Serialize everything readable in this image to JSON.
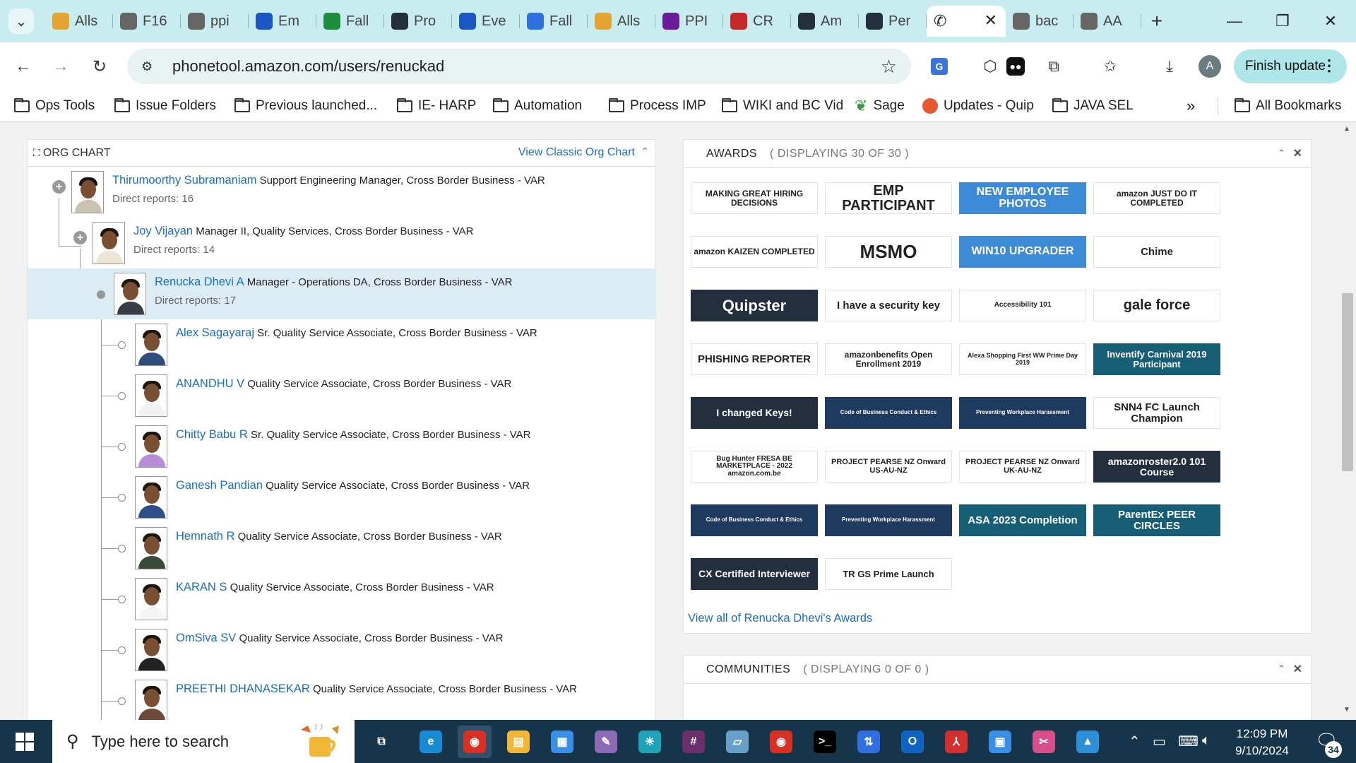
{
  "browser": {
    "tabs": [
      {
        "label": "Alls",
        "icon": "bee-icon",
        "color": "#e4a530"
      },
      {
        "label": "F16",
        "icon": "globe-icon",
        "color": "#666666"
      },
      {
        "label": "ppi",
        "icon": "globe-icon",
        "color": "#666666"
      },
      {
        "label": "Em",
        "icon": "mail-icon",
        "color": "#1a56c4"
      },
      {
        "label": "Fall",
        "icon": "sheet-icon",
        "color": "#1e8e3e"
      },
      {
        "label": "Pro",
        "icon": "quip-icon",
        "color": "#232f3e"
      },
      {
        "label": "Eve",
        "icon": "mail-icon",
        "color": "#1a56c4"
      },
      {
        "label": "Fall",
        "icon": "doc-icon",
        "color": "#2f6fe0"
      },
      {
        "label": "Alls",
        "icon": "bee-icon",
        "color": "#e4a530"
      },
      {
        "label": "PPI",
        "icon": "ppm-icon",
        "color": "#6a1b9a"
      },
      {
        "label": "CR",
        "icon": "cr-icon",
        "color": "#c62828"
      },
      {
        "label": "Am",
        "icon": "quip-icon",
        "color": "#232f3e"
      },
      {
        "label": "Per",
        "icon": "quip-icon",
        "color": "#232f3e"
      }
    ],
    "active_tab": {
      "icon": "phone-icon",
      "close": "✕"
    },
    "trailing_tabs": [
      {
        "label": "bac",
        "icon": "globe-icon",
        "color": "#666666"
      },
      {
        "label": "AA",
        "icon": "globe-icon",
        "color": "#666666"
      }
    ],
    "url": "phonetool.amazon.com/users/renuckad",
    "profile_initial": "A",
    "finish_update": "Finish update",
    "bookmarks": [
      {
        "label": "Ops Tools",
        "type": "folder"
      },
      {
        "label": "Issue Folders",
        "type": "folder"
      },
      {
        "label": "Previous launched...",
        "type": "folder"
      },
      {
        "label": "IE- HARP",
        "type": "folder"
      },
      {
        "label": "Automation",
        "type": "folder"
      },
      {
        "label": "Process IMP",
        "type": "folder"
      },
      {
        "label": "WIKI and BC Vid",
        "type": "folder"
      },
      {
        "label": "Sage",
        "type": "leaf",
        "color": "#2e9b3e"
      },
      {
        "label": "Updates - Quip",
        "type": "quip",
        "color": "#e8572f"
      },
      {
        "label": "JAVA SEL",
        "type": "folder"
      }
    ],
    "more_bookmarks": "»",
    "all_bookmarks": "All Bookmarks"
  },
  "org_chart": {
    "title": "ORG CHART",
    "classic_link": "View Classic Org Chart",
    "people": [
      {
        "name": "Thirumoorthy Subramaniam",
        "title": "Support Engineering Manager, Cross Border Business - VAR",
        "direct_reports": "Direct reports: 16",
        "shirt": "#c9c2b0"
      },
      {
        "name": "Joy Vijayan",
        "title": "Manager II, Quality Services, Cross Border Business - VAR",
        "direct_reports": "Direct reports: 14",
        "shirt": "#ece6d4"
      },
      {
        "name": "Renucka Dhevi A",
        "title": "Manager - Operations DA, Cross Border Business - VAR",
        "direct_reports": "Direct reports: 17",
        "shirt": "#3b3b48"
      },
      {
        "name": "Alex Sagayaraj",
        "title": "Sr. Quality Service Associate, Cross Border Business - VAR",
        "shirt": "#2f4d7a"
      },
      {
        "name": "ANANDHU V",
        "title": "Quality Service Associate, Cross Border Business - VAR",
        "shirt": "#f1f1f1"
      },
      {
        "name": "Chitty Babu R",
        "title": "Sr. Quality Service Associate, Cross Border Business - VAR",
        "shirt": "#b48fd8"
      },
      {
        "name": "Ganesh Pandian",
        "title": "Quality Service Associate, Cross Border Business - VAR",
        "shirt": "#2d4e8a"
      },
      {
        "name": "Hemnath R",
        "title": "Quality Service Associate, Cross Border Business - VAR",
        "shirt": "#3a4a3a"
      },
      {
        "name": "KARAN S",
        "title": "Quality Service Associate, Cross Border Business - VAR",
        "shirt": "#f5f5f5"
      },
      {
        "name": "OmSiva SV",
        "title": "Quality Service Associate, Cross Border Business - VAR",
        "shirt": "#222222"
      },
      {
        "name": "PREETHI DHANASEKAR",
        "title": "Quality Service Associate, Cross Border Business - VAR",
        "shirt": "#6d4a3a"
      }
    ]
  },
  "awards": {
    "title": "AWARDS",
    "count": "( DISPLAYING 30 OF 30 )",
    "badges": [
      "MAKING GREAT HIRING DECISIONS",
      "EMP PARTICIPANT",
      "NEW EMPLOYEE PHOTOS",
      "amazon JUST DO IT COMPLETED",
      "amazon KAIZEN COMPLETED",
      "MSMO",
      "WIN10 UPGRADER",
      "Chime",
      "Quipster",
      "I have a security key",
      "Accessibility 101",
      "gale force",
      "PHISHING REPORTER",
      "amazonbenefits Open Enrollment 2019",
      "Alexa Shopping First WW Prime Day 2019",
      "Inventify Carnival 2019 Participant",
      "I changed Keys!",
      "Code of Business Conduct & Ethics",
      "Preventing Workplace Harassment",
      "SNN4 FC Launch Champion",
      "Bug Hunter FRESA BE MARKETPLACE - 2022 amazon.com.be",
      "PROJECT PEARSE NZ Onward US-AU-NZ",
      "PROJECT PEARSE NZ Onward UK-AU-NZ",
      "amazonroster2.0 101 Course",
      "Code of Business Conduct & Ethics",
      "Preventing Workplace Harassment",
      "ASA 2023 Completion",
      "ParentEx PEER CIRCLES",
      "CX Certified Interviewer",
      "TR GS Prime Launch"
    ],
    "view_all": "View all of Renucka Dhevi's Awards"
  },
  "communities": {
    "title": "COMMUNITIES",
    "count": "( DISPLAYING 0 OF 0 )"
  },
  "taskbar": {
    "search_placeholder": "Type here to search",
    "time": "12:09 PM",
    "date": "9/10/2024",
    "notifications": "34"
  }
}
